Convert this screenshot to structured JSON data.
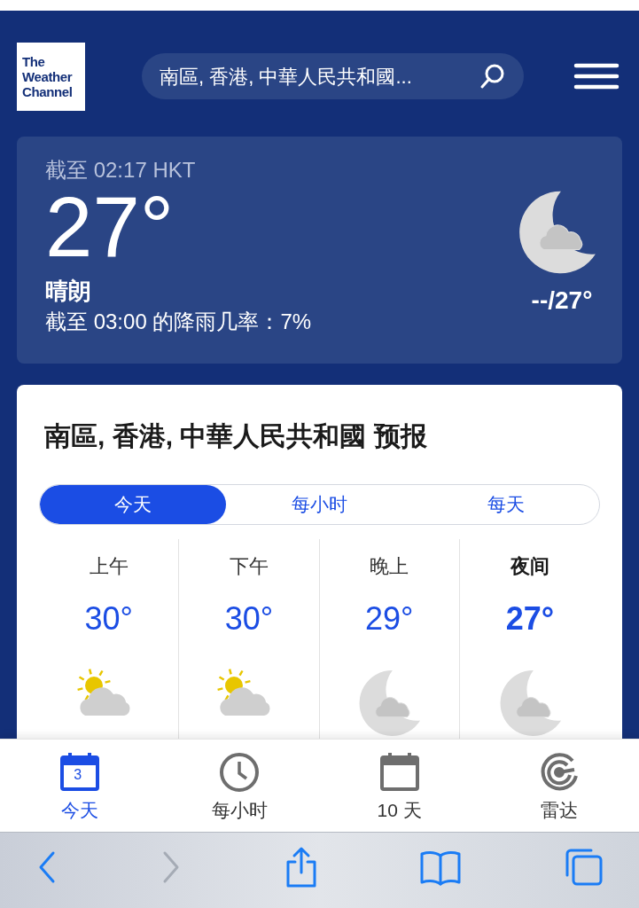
{
  "header": {
    "logo": [
      "The",
      "Weather",
      "Channel"
    ],
    "search": {
      "value": "南區, 香港, 中華人民共和國..."
    }
  },
  "current": {
    "as_of": "截至 02:17 HKT",
    "temperature": "27°",
    "condition": "晴朗",
    "rain_chance": "截至 03:00 的降雨几率：7%",
    "hi_lo": "--/27°",
    "kind": "cloudy-night"
  },
  "forecast": {
    "title": "南區, 香港, 中華人民共和國 预报",
    "tabs": [
      {
        "label": "今天",
        "selected": true
      },
      {
        "label": "每小时",
        "selected": false
      },
      {
        "label": "每天",
        "selected": false
      }
    ],
    "periods": [
      {
        "label": "上午",
        "temperature": "30°",
        "kind": "partly-cloudy-day",
        "current": false
      },
      {
        "label": "下午",
        "temperature": "30°",
        "kind": "partly-cloudy-day",
        "current": false
      },
      {
        "label": "晚上",
        "temperature": "29°",
        "kind": "cloudy-night",
        "current": false
      },
      {
        "label": "夜间",
        "temperature": "27°",
        "kind": "cloudy-night",
        "current": true
      }
    ]
  },
  "bottom_nav": [
    {
      "label": "今天",
      "kind": "calendar-day",
      "badge": "3",
      "selected": true
    },
    {
      "label": "每小时",
      "kind": "clock",
      "selected": false
    },
    {
      "label": "10 天",
      "kind": "calendar",
      "selected": false
    },
    {
      "label": "雷达",
      "kind": "radar",
      "selected": false
    }
  ],
  "browser_toolbar": [
    {
      "kind": "back",
      "disabled": false
    },
    {
      "kind": "forward",
      "disabled": true
    },
    {
      "kind": "share",
      "disabled": false
    },
    {
      "kind": "bookmarks",
      "disabled": false
    },
    {
      "kind": "tabs",
      "disabled": false
    }
  ]
}
